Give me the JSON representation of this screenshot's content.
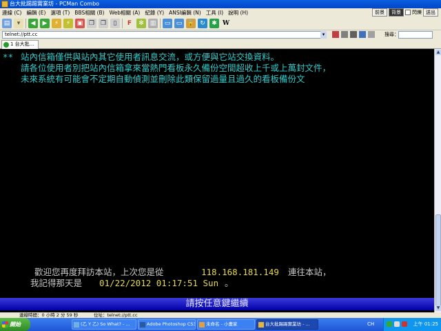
{
  "window": {
    "title": "台大批踢踢實業坊 - PCMan Combo"
  },
  "menu": {
    "items": [
      "連線 (C)",
      "編輯 (E)",
      "選項 (T)",
      "BBS相關 (B)",
      "Web相關 (A)",
      "紀錄 (Y)",
      "ANSI編輯 (N)",
      "工具 (I)",
      "說明 (H)"
    ],
    "right_buttons": [
      "前景",
      "背景",
      "閃爍",
      "送出"
    ]
  },
  "toolbar": {
    "icons": [
      "new-connection-icon",
      "site-list-icon",
      "back-icon",
      "forward-icon",
      "reconnect-icon",
      "disconnect-icon",
      "copy-icon",
      "paste-icon",
      "paste-all-icon",
      "font-icon",
      "settings-icon",
      "ansi-icon",
      "lock-icon",
      "refresh-icon",
      "star-icon",
      "wiki-icon"
    ],
    "letters": {
      "font": "F",
      "wiki": "W"
    }
  },
  "address": {
    "value": "telnet://ptt.cc",
    "search_label": "搜尋："
  },
  "tabs": [
    {
      "label": "1 台大批..."
    }
  ],
  "terminal": {
    "line1_prefix": "**",
    "line1": "站內信箱僅供與站內其它使用者訊息交流，或方便與它站交換資料。",
    "line2": "請各位使用者別把站內信箱拿來當熱門看板永久備份空間超收上千或上萬封文件，",
    "line3": "未來系統有可能會不定期自動偵測並刪除此類保留過量且過久的看板備份文",
    "welcome_text": "歡迎您再度拜訪本站，上次您是從",
    "welcome_ip": "118.168.181.149",
    "welcome_suffix": "連往本站，",
    "remember_text": "我記得那天是",
    "remember_date": "01/22/2012 01:17:51 Sun",
    "remember_end": "。",
    "press_any_key": "請按任意鍵繼續"
  },
  "statusbar": {
    "connect_time": "連線時間：0 小時 2 分 59 秒",
    "location": "位址：telnet://ptt.cc"
  },
  "taskbar": {
    "start_label": "開始",
    "items": [
      {
        "label": "(乙 Y 乙) So What? - ...",
        "active": false
      },
      {
        "label": "Adobe Photoshop CS3 ...",
        "active": false
      },
      {
        "label": "未命名 - 小畫家",
        "active": false
      },
      {
        "label": "台大批踢踢實業坊 - ...",
        "active": true
      }
    ],
    "lang": "CH",
    "clock": "上午 01:25"
  },
  "colors": {
    "terminal_bg": "#000000",
    "terminal_cyan": "#33cccc",
    "terminal_grey": "#c8c8c8",
    "terminal_yellow": "#e6d84a",
    "pressbar": "#0000a8",
    "taskbar": "#1f57d6"
  }
}
